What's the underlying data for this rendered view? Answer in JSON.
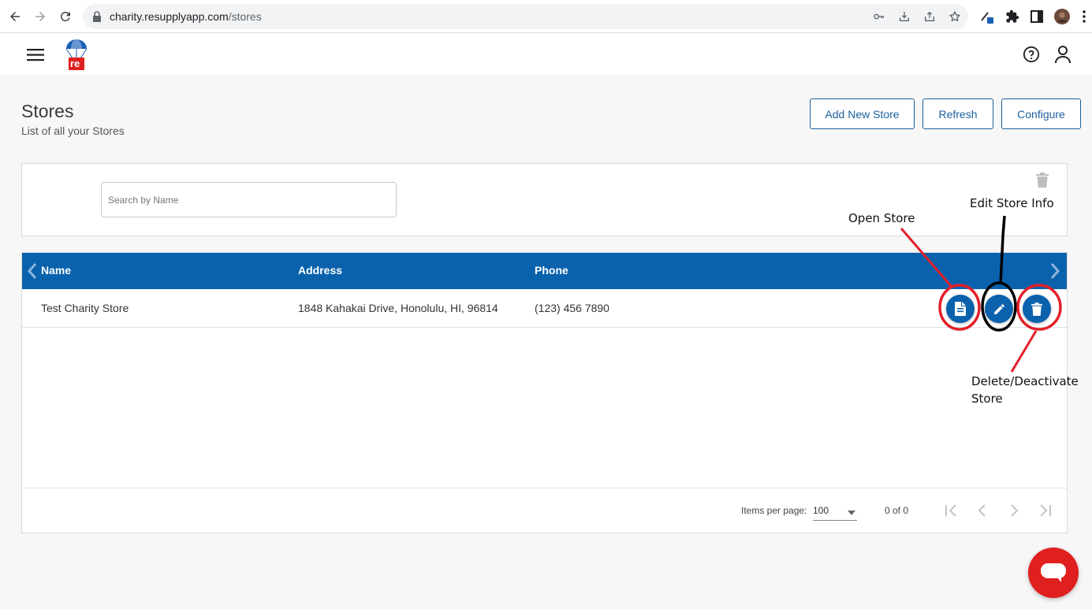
{
  "browser": {
    "url_host": "charity.resupplyapp.com",
    "url_path": "/stores"
  },
  "app": {
    "logo_text": "re"
  },
  "page": {
    "title": "Stores",
    "subtitle": "List of all your Stores",
    "buttons": {
      "add_new_store": "Add New Store",
      "refresh": "Refresh",
      "configure": "Configure"
    }
  },
  "search": {
    "placeholder": "Search by Name",
    "value": ""
  },
  "table": {
    "columns": [
      "Name",
      "Address",
      "Phone"
    ],
    "rows": [
      {
        "name": "Test Charity Store",
        "address": "1848 Kahakai Drive, Honolulu, HI, 96814",
        "phone": "(123) 456 7890"
      }
    ]
  },
  "pagination": {
    "items_per_page_label": "Items per page:",
    "items_per_page": "100",
    "range": "0 of 0"
  },
  "annotations": {
    "open_store": "Open Store",
    "edit_store": "Edit Store Info",
    "delete_line1": "Delete/Deactivate",
    "delete_line2": "Store"
  },
  "colors": {
    "primary": "#0a62ad",
    "annotation_red": "#e2202a",
    "annotation_black": "#000000",
    "chat_red": "#e0201f"
  }
}
